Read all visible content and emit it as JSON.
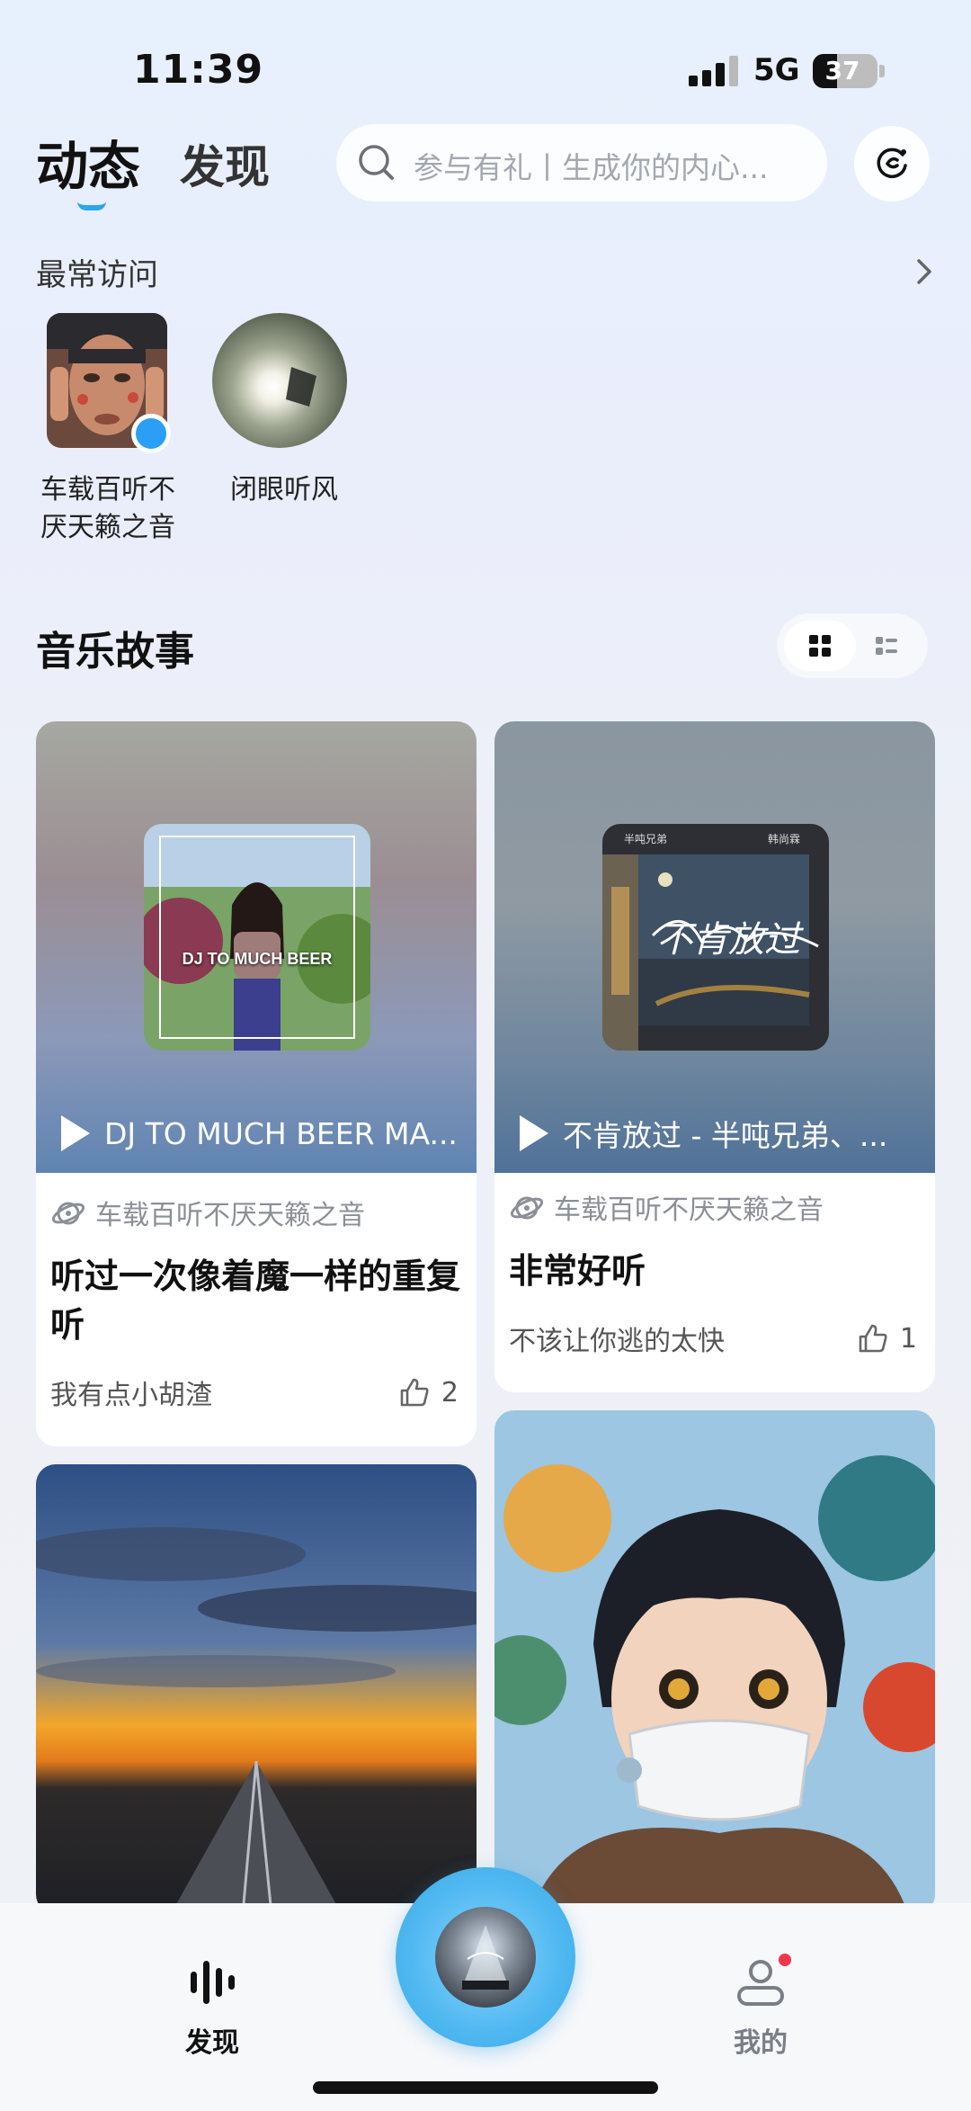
{
  "status_bar": {
    "time": "11:39",
    "network": "5G",
    "battery": "37",
    "battery_level": 0.37
  },
  "header": {
    "tabs": [
      {
        "label": "动态",
        "active": true
      },
      {
        "label": "发现",
        "active": false
      }
    ],
    "search_placeholder": "参与有礼丨生成你的内心...",
    "right_icon": "refresh-music-icon"
  },
  "frequent": {
    "title": "最常访问",
    "items": [
      {
        "name": "车载百听不\n厌天籁之音",
        "line1": "车载百听不",
        "line2": "厌天籁之音",
        "online": true
      },
      {
        "name": "闭眼听风",
        "line1": "闭眼听风",
        "line2": "",
        "online": false
      }
    ]
  },
  "music_story": {
    "title": "音乐故事",
    "view_modes": [
      "grid-view-icon",
      "list-view-icon"
    ],
    "active_view": "grid",
    "cards": [
      {
        "song": "DJ TO MUCH BEER MA...",
        "album_text": "DJ TO MUCH BEER",
        "author": "车载百听不厌天籁之音",
        "headline": "听过一次像着魔一样的重复听",
        "user": "我有点小胡渣",
        "likes": "2"
      },
      {
        "song": "不肯放过 - 半吨兄弟、...",
        "album_text": "不肯放过",
        "album_small_left": "半吨兄弟",
        "album_small_right": "韩尚霖",
        "author": "车载百听不厌天籁之音",
        "headline": "非常好听",
        "user": "不该让你逃的太快",
        "likes": "1"
      }
    ]
  },
  "bottom_nav": {
    "items": [
      {
        "label": "发现",
        "icon": "soundwave-icon",
        "active": true
      },
      {
        "label": "我的",
        "icon": "profile-icon",
        "active": false,
        "badge": true
      }
    ],
    "center": "now-playing-disc"
  },
  "colors": {
    "accent": "#2aa6f0",
    "badge": "#f2364e",
    "disc": "#4fb8f0"
  }
}
